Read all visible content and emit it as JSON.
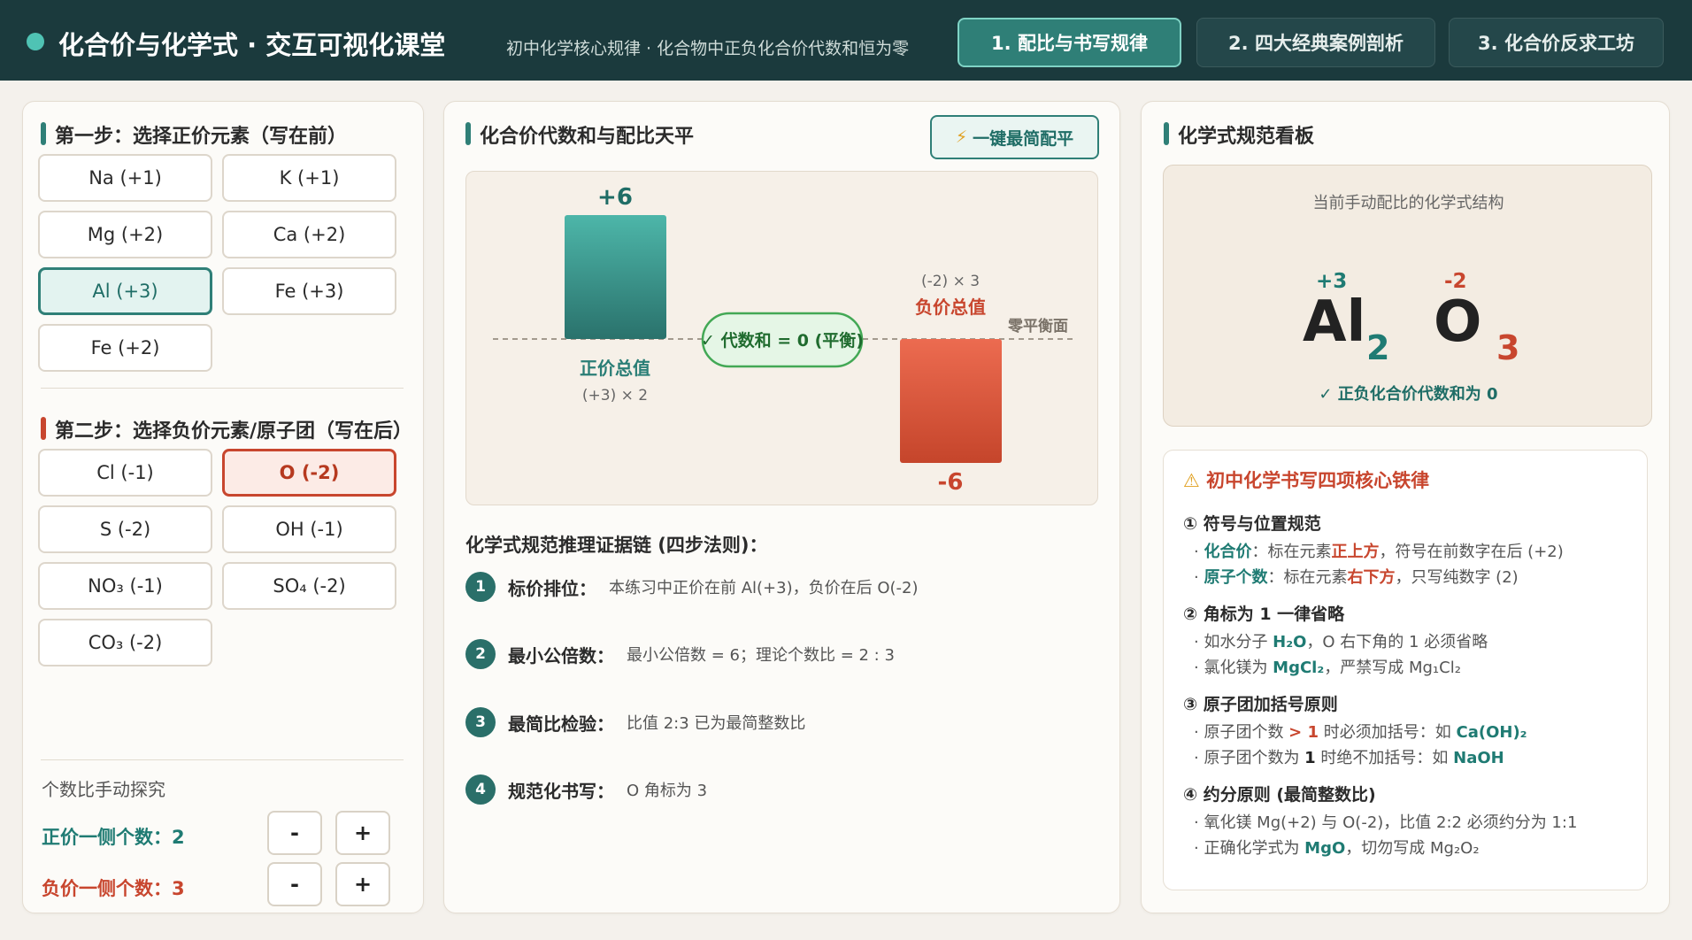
{
  "header": {
    "title": "化合价与化学式 · 交互可视化课堂",
    "subtitle": "初中化学核心规律 · 化合物中正负化合价代数和恒为零",
    "tabs": [
      "1. 配比与书写规律",
      "2. 四大经典案例剖析",
      "3. 化合价反求工坊"
    ],
    "active_tab": 0
  },
  "left": {
    "step1_title": "第一步：选择正价元素（写在前）",
    "positive": [
      "Na (+1)",
      "K (+1)",
      "Mg (+2)",
      "Ca (+2)",
      "Al (+3)",
      "Fe (+3)",
      "Fe (+2)"
    ],
    "positive_selected": "Al (+3)",
    "step2_title": "第二步：选择负价元素/原子团（写在后）",
    "negative": [
      "Cl (-1)",
      "O (-2)",
      "S (-2)",
      "OH (-1)",
      "NO₃ (-1)",
      "SO₄ (-2)",
      "CO₃ (-2)"
    ],
    "negative_selected": "O (-2)",
    "ratio_title": "个数比手动探究",
    "pos_count_label": "正价一侧个数：2",
    "neg_count_label": "负价一侧个数：3",
    "minus": "-",
    "plus": "+"
  },
  "middle": {
    "title": "化合价代数和与配比天平",
    "balance_button": "一键最简配平",
    "balance_icon": "lightning-icon",
    "evidence_title": "化学式规范推理证据链 (四步法则)：",
    "steps": [
      {
        "num": "1",
        "name": "标价排位：",
        "text": "本练习中正价在前 Al(+3)，负价在后 O(-2)"
      },
      {
        "num": "2",
        "name": "最小公倍数：",
        "text": "最小公倍数 = 6；理论个数比 = 2 : 3"
      },
      {
        "num": "3",
        "name": "最简比检验：",
        "text": "比值 2:3 已为最简整数比"
      },
      {
        "num": "4",
        "name": "规范化书写：",
        "text": "O 角标为 3"
      }
    ]
  },
  "chart_data": {
    "type": "bar",
    "categories": [
      "正价总值",
      "负价总值"
    ],
    "values": [
      6,
      -6
    ],
    "value_labels": [
      "+6",
      "-6"
    ],
    "positive_label": "正价总值",
    "positive_formula": "(+3) × 2",
    "negative_label": "负价总值",
    "negative_formula": "(-2) × 3",
    "zero_line_label": "零平衡面",
    "balance_badge": "✓ 代数和 = 0 (平衡)",
    "ylim": [
      -6,
      6
    ],
    "colors": {
      "positive": "#2f8f86",
      "negative": "#d2553a"
    }
  },
  "right": {
    "title": "化学式规范看板",
    "caption": "当前手动配比的化学式结构",
    "formula": {
      "el1": "Al",
      "val1": "+3",
      "sub1": "2",
      "el2": "O",
      "val2": "-2",
      "sub2": "3"
    },
    "check": "✓ 正负化合价代数和为 0",
    "rules_title": "初中化学书写四项核心铁律",
    "warning_icon": "warning-icon"
  },
  "colors": {
    "teal": "#2f7f77",
    "red": "#c8462e",
    "header": "#1b3a3d"
  }
}
